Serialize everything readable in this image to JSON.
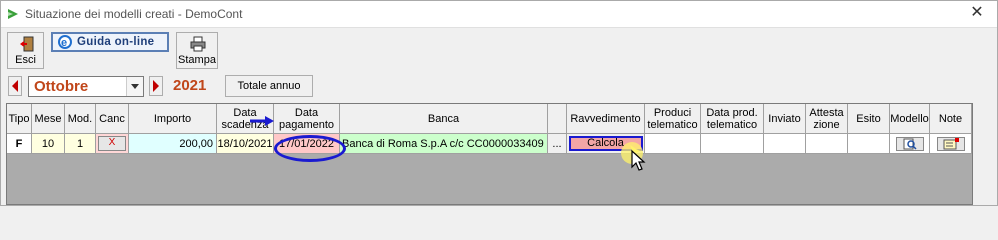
{
  "window": {
    "title": "Situazione dei modelli creati - DemoCont",
    "close_label": "✕"
  },
  "toolbar": {
    "esci_label": "Esci",
    "guida_label": "Guida on-line",
    "stampa_label": "Stampa"
  },
  "period": {
    "month": "Ottobre",
    "year": "2021",
    "totale_label": "Totale annuo"
  },
  "grid": {
    "headers": {
      "tipo": "Tipo",
      "mese": "Mese",
      "mod": "Mod.",
      "canc": "Canc",
      "importo": "Importo",
      "data_scadenza": "Data scadenza",
      "data_pagamento": "Data pagamento",
      "banca": "Banca",
      "ravvedimento": "Ravvedimento",
      "produci": "Produci telematico",
      "data_prod": "Data prod. telematico",
      "inviato": "Inviato",
      "attestazione": "Attesta zione",
      "esito": "Esito",
      "modello": "Modello",
      "note": "Note"
    },
    "row": {
      "tipo": "F",
      "mese": "10",
      "mod": "1",
      "canc": "X",
      "importo": "200,00",
      "data_scadenza": "18/10/2021",
      "data_pagamento": "17/01/2022",
      "banca": "Banca di Roma S.p.A c/c CC0000033409",
      "dots": "...",
      "ravvedimento": "Calcola"
    }
  },
  "colors": {
    "annotation": "#1a1ad0",
    "month_text": "#c0461a",
    "calcola_bg": "#f3a6a6"
  }
}
